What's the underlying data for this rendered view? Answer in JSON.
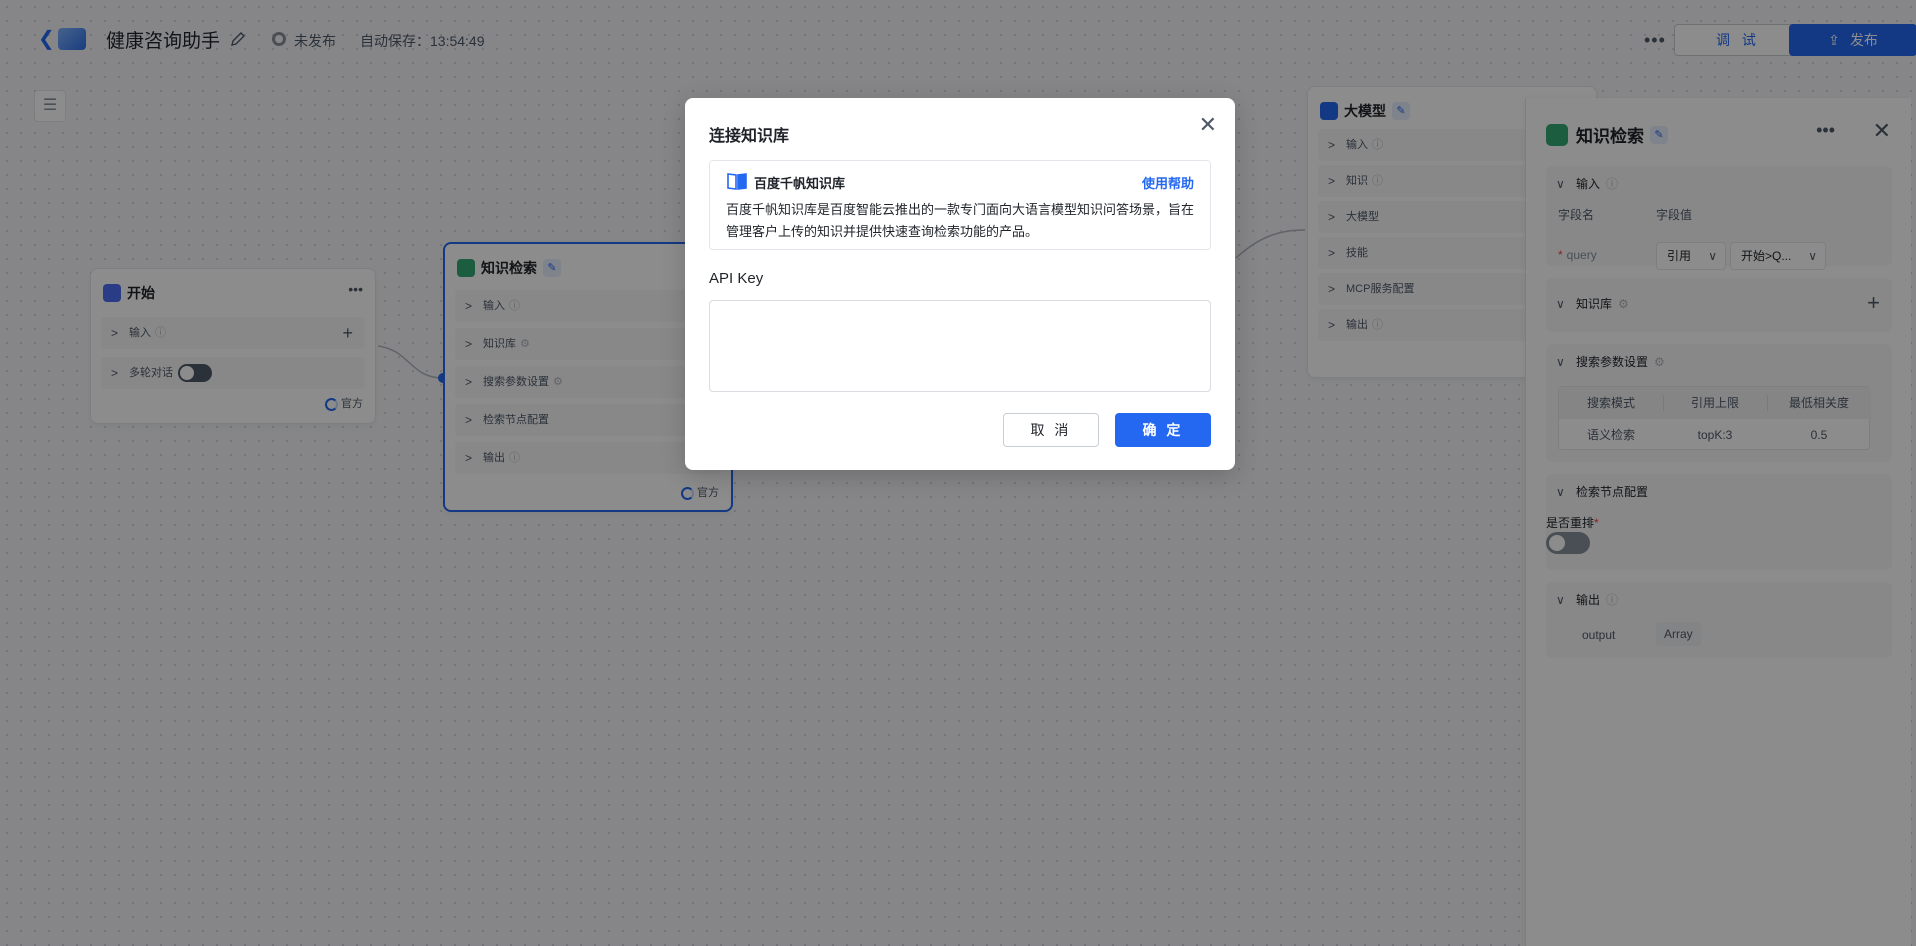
{
  "header": {
    "title": "健康咨询助手",
    "status": "未发布",
    "autosave": "自动保存：13:54:49",
    "debug_label": "调 试",
    "publish_label": "发布"
  },
  "nodes": {
    "start": {
      "title": "开始",
      "rows": [
        "输入",
        "多轮对话"
      ],
      "official": "官方"
    },
    "knowledge": {
      "title": "知识检索",
      "rows": [
        "输入",
        "知识库",
        "搜索参数设置",
        "检索节点配置",
        "输出"
      ],
      "official": "官方"
    },
    "llm": {
      "title": "大模型",
      "rows": [
        "输入",
        "知识",
        "大模型",
        "技能",
        "MCP服务配置",
        "输出"
      ]
    }
  },
  "panel": {
    "title": "知识检索",
    "input": {
      "label": "输入",
      "col_name": "字段名",
      "col_value": "字段值",
      "field": "query",
      "ref": "引用",
      "value": "开始>Q..."
    },
    "kb": {
      "label": "知识库"
    },
    "search": {
      "label": "搜索参数设置",
      "headers": [
        "搜索模式",
        "引用上限",
        "最低相关度"
      ],
      "values": [
        "语义检索",
        "topK:3",
        "0.5"
      ]
    },
    "node_config": {
      "label": "检索节点配置",
      "rerank_label": "是否重排"
    },
    "output": {
      "label": "输出",
      "name": "output",
      "type": "Array"
    }
  },
  "modal": {
    "title": "连接知识库",
    "kb_name": "百度千帆知识库",
    "help": "使用帮助",
    "desc": "百度千帆知识库是百度智能云推出的一款专门面向大语言模型知识问答场景，旨在管理客户上传的知识并提供快速查询检索功能的产品。",
    "api_label": "API Key",
    "api_value": "",
    "cancel": "取 消",
    "ok": "确 定"
  },
  "colors": {
    "primary": "#2468f2",
    "kb_icon": "#33a873",
    "start_icon": "#4e6ef2"
  }
}
